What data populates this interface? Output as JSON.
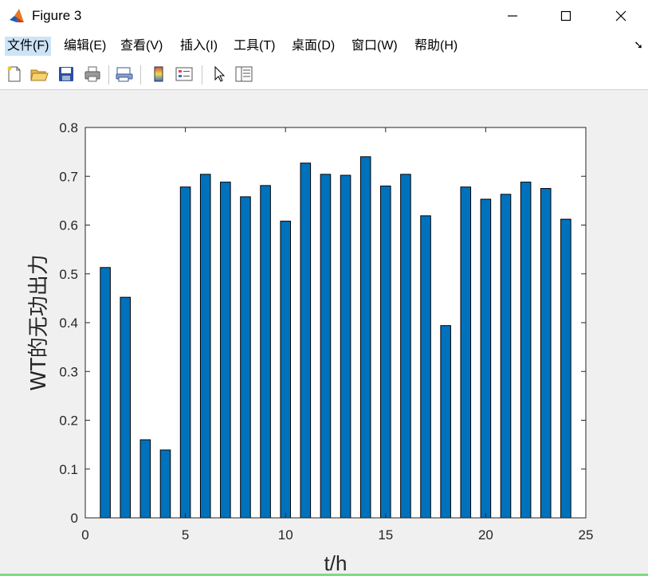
{
  "window": {
    "title": "Figure 3"
  },
  "menu": {
    "items": [
      "文件(F)",
      "编辑(E)",
      "查看(V)",
      "插入(I)",
      "工具(T)",
      "桌面(D)",
      "窗口(W)",
      "帮助(H)"
    ]
  },
  "toolbar": {
    "icons": [
      "new-file-icon",
      "open-folder-icon",
      "save-icon",
      "print-icon",
      "print-preview-icon",
      "colorbar-icon",
      "legend-icon",
      "pointer-icon",
      "property-panel-icon"
    ]
  },
  "colors": {
    "bar_fill": "#0072bd",
    "bar_edge": "#000000",
    "figure_bg": "#f0f0f0",
    "axes_bg": "#ffffff"
  },
  "chart_data": {
    "type": "bar",
    "x": [
      1,
      2,
      3,
      4,
      5,
      6,
      7,
      8,
      9,
      10,
      11,
      12,
      13,
      14,
      15,
      16,
      17,
      18,
      19,
      20,
      21,
      22,
      23,
      24
    ],
    "values": [
      0.513,
      0.452,
      0.16,
      0.139,
      0.678,
      0.704,
      0.688,
      0.658,
      0.681,
      0.608,
      0.727,
      0.704,
      0.702,
      0.74,
      0.68,
      0.704,
      0.619,
      0.394,
      0.678,
      0.653,
      0.663,
      0.688,
      0.675,
      0.612
    ],
    "xlabel": "t/h",
    "ylabel": "WT的无功出力",
    "xlim": [
      0,
      25
    ],
    "ylim": [
      0,
      0.8
    ],
    "xticks": [
      "0",
      "5",
      "10",
      "15",
      "20",
      "25"
    ],
    "yticks": [
      "0",
      "0.1",
      "0.2",
      "0.3",
      "0.4",
      "0.5",
      "0.6",
      "0.7",
      "0.8"
    ],
    "grid": false
  }
}
